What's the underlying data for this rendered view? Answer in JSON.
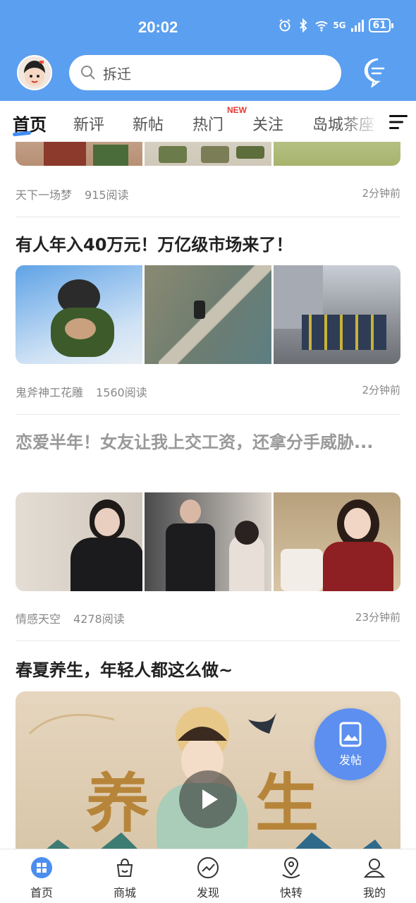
{
  "status_bar": {
    "time": "20:02",
    "network": "5G",
    "battery": "61"
  },
  "header": {
    "search_placeholder": "拆迁",
    "icons": [
      "avatar",
      "search-icon",
      "message-icon"
    ]
  },
  "tabs": {
    "items": [
      "首页",
      "新评",
      "新帖",
      "热门",
      "关注",
      "岛城茶座"
    ],
    "active": "首页",
    "new_badge": "NEW"
  },
  "feed": {
    "posts": [
      {
        "author": "天下一场梦",
        "reads": "915阅读",
        "time": "2分钟前"
      },
      {
        "title": "有人年入40万元！万亿级市场来了！",
        "author": "鬼斧神工花雕",
        "reads": "1560阅读",
        "time": "2分钟前"
      },
      {
        "title": "恋爱半年！女友让我上交工资，还拿分手威胁...",
        "author": "情感天空",
        "reads": "4278阅读",
        "time": "23分钟前"
      },
      {
        "title": "春夏养生，年轻人都这么做~"
      }
    ]
  },
  "fab": {
    "label": "发帖"
  },
  "bottom_nav": {
    "items": [
      "首页",
      "商城",
      "发现",
      "快转",
      "我的"
    ],
    "active": "首页"
  },
  "colors": {
    "primary": "#5b9ff0",
    "accent": "#3e8ef7",
    "new_badge": "#e53935"
  }
}
